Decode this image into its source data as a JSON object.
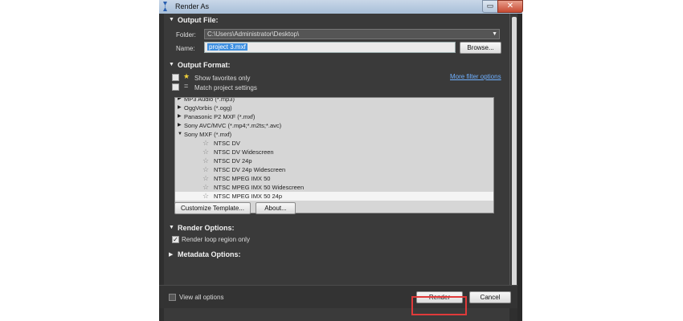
{
  "window": {
    "title": "Render As"
  },
  "output_file": {
    "heading": "Output File:",
    "folder_label": "Folder:",
    "folder_value": "C:\\Users\\Administrator\\Desktop\\",
    "name_label": "Name:",
    "name_value": "project 3.mxf",
    "browse_label": "Browse..."
  },
  "output_format": {
    "heading": "Output Format:",
    "show_favorites_label": "Show favorites only",
    "match_settings_label": "Match project settings",
    "more_filter_link": "More filter options",
    "list_items": [
      {
        "label": "MP3 Audio (*.mp3)",
        "kind": "group",
        "expanded": false
      },
      {
        "label": "OggVorbis (*.ogg)",
        "kind": "group",
        "expanded": false
      },
      {
        "label": "Panasonic P2 MXF (*.mxf)",
        "kind": "group",
        "expanded": false
      },
      {
        "label": "Sony AVC/MVC (*.mp4;*.m2ts;*.avc)",
        "kind": "group",
        "expanded": false
      },
      {
        "label": "Sony MXF (*.mxf)",
        "kind": "group",
        "expanded": true
      },
      {
        "label": "NTSC DV",
        "kind": "template"
      },
      {
        "label": "NTSC DV Widescreen",
        "kind": "template"
      },
      {
        "label": "NTSC DV 24p",
        "kind": "template"
      },
      {
        "label": "NTSC DV 24p Widescreen",
        "kind": "template"
      },
      {
        "label": "NTSC MPEG IMX 50",
        "kind": "template"
      },
      {
        "label": "NTSC MPEG IMX 50 Widescreen",
        "kind": "template"
      },
      {
        "label": "NTSC MPEG IMX 50 24p",
        "kind": "template",
        "selected": true
      }
    ],
    "customize_label": "Customize Template...",
    "about_label": "About..."
  },
  "render_options": {
    "heading": "Render Options:",
    "loop_region_label": "Render loop region only",
    "loop_region_checked": true
  },
  "metadata_options": {
    "heading": "Metadata Options:"
  },
  "footer": {
    "view_all_label": "View all options",
    "render_label": "Render",
    "cancel_label": "Cancel"
  },
  "colors": {
    "highlight_outline": "#e03a3a",
    "link": "#6fb0ff"
  }
}
